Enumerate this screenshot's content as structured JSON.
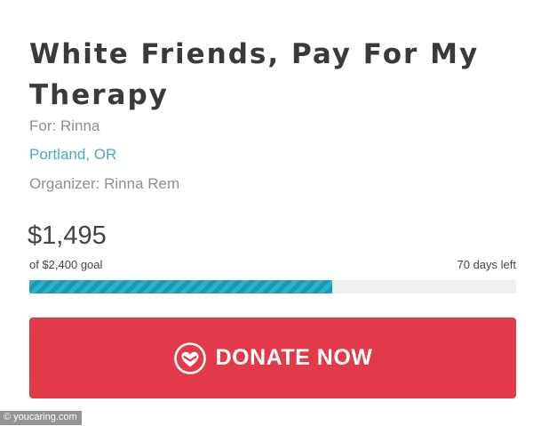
{
  "campaign": {
    "title": "White Friends, Pay For My Therapy",
    "beneficiary": "For: Rinna",
    "location": "Portland, OR",
    "organizer": "Organizer: Rinna Rem"
  },
  "funding": {
    "raised": "$1,495",
    "goal_text": "of $2,400 goal",
    "days_left": "70 days left",
    "progress_fraction": 0.623,
    "progress_color": "#27a9c4"
  },
  "donate": {
    "label": "DONATE NOW",
    "icon": "heart-in-circle-icon",
    "button_color": "#e23a48"
  },
  "watermark": {
    "text": "© youcaring.com"
  }
}
